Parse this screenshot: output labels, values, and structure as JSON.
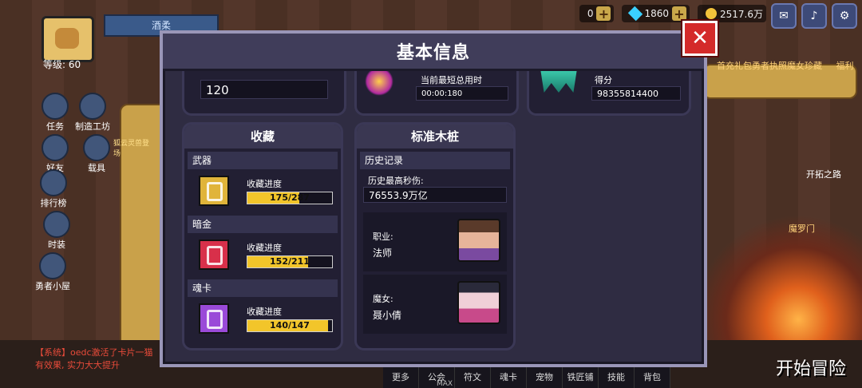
{
  "hud": {
    "level": "等级: 60",
    "left_tab": "酒柔",
    "resources": [
      {
        "name": "gem-resource",
        "value": "0"
      },
      {
        "name": "diamond-resource",
        "value": "1860"
      },
      {
        "name": "gold-resource",
        "value": "2517.6万"
      }
    ],
    "left_nav": [
      "任务",
      "制造工坊",
      "好友",
      "载具",
      "排行榜",
      "时装",
      "勇者小屋"
    ],
    "event_label": "狐云灵兽登场",
    "right_top_labels": [
      "首充礼包",
      "勇者执照",
      "魔女珍藏",
      "福利"
    ],
    "right_side": {
      "road": "开拓之路",
      "gate": "魔罗门"
    },
    "chat_lines": [
      "【系统】oedc激活了卡片一猫",
      "有效果, 实力大大提升"
    ],
    "bottom_tabs": [
      "更多",
      "公会",
      "符文",
      "魂卡",
      "宠物",
      "铁匠铺",
      "技能",
      "背包"
    ],
    "max_label": "MAX",
    "start_button": "开始冒险"
  },
  "dialog": {
    "title": "基本信息",
    "close_icon": "close-x-icon",
    "top_cards": {
      "left_value": "120",
      "middle_label": "当前最短总用时",
      "middle_value": "00:00:180",
      "right_label": "得分",
      "right_value": "98355814400"
    },
    "collection": {
      "title": "收藏",
      "rows": [
        {
          "name": "武器",
          "progress_label": "收藏进度",
          "progress_text": "175/287",
          "progress": 0.61,
          "color": "#e0b43a"
        },
        {
          "name": "暗金",
          "progress_label": "收藏进度",
          "progress_text": "152/211",
          "progress": 0.72,
          "color": "#d8304a"
        },
        {
          "name": "魂卡",
          "progress_label": "收藏进度",
          "progress_text": "140/147",
          "progress": 0.95,
          "color": "#9a4ad8"
        }
      ]
    },
    "stake": {
      "title": "标准木桩",
      "history_header": "历史记录",
      "best_label": "历史最高秒伤:",
      "best_value": "76553.9万亿",
      "class_label": "职业:",
      "class_value": "法师",
      "witch_label": "魔女:",
      "witch_value": "聂小倩"
    }
  }
}
